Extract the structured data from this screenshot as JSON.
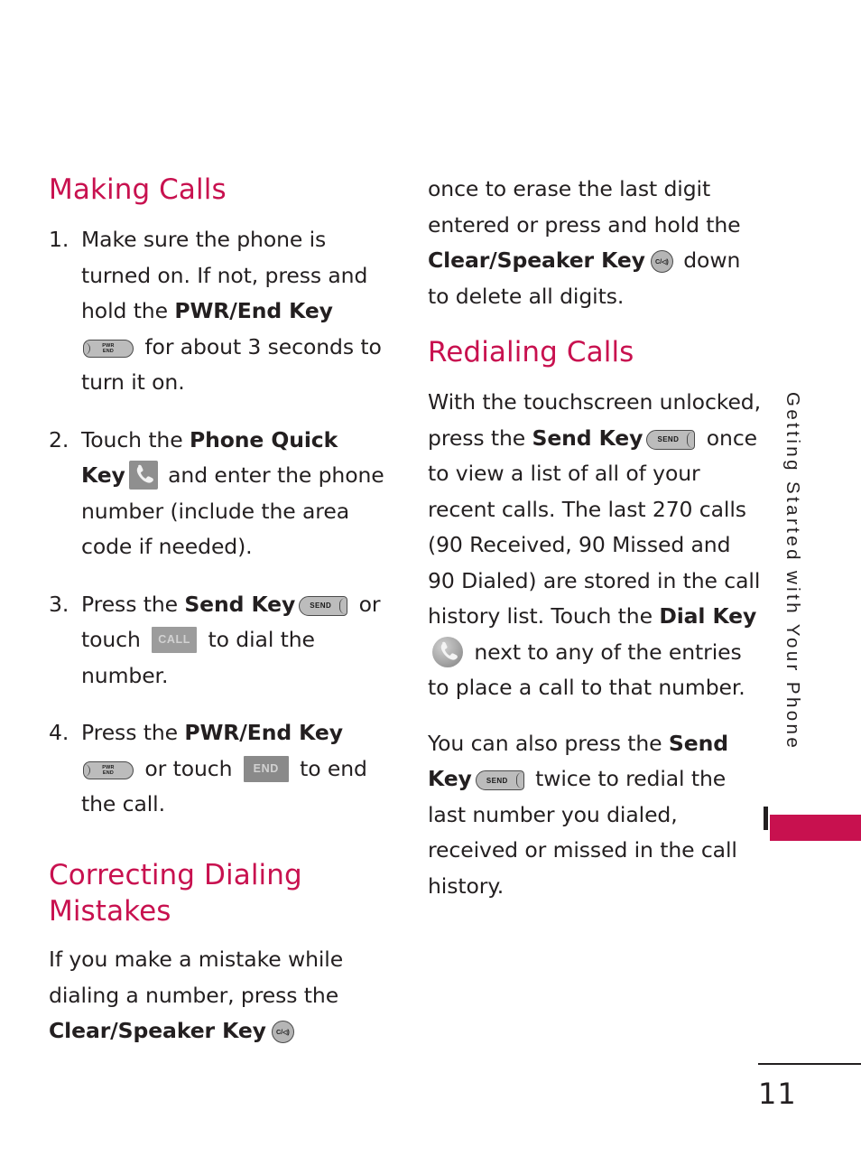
{
  "page": {
    "number": "11",
    "side_tab_label": "Getting Started with Your Phone",
    "accent_color": "#c8114f",
    "text_color": "#231f20"
  },
  "left_column": {
    "heading_making_calls": "Making Calls",
    "steps": [
      {
        "num": "1.",
        "part1": "Make sure the phone is turned on. If not, press and hold the ",
        "bold1": "PWR/End Key",
        "icon1": "pwr-end-key",
        "part2": " for about 3 seconds to turn it on."
      },
      {
        "num": "2.",
        "part1": "Touch the ",
        "bold1": "Phone Quick Key",
        "icon1": "phone-quick-key",
        "part2": " and enter the phone number (include the area code if needed)."
      },
      {
        "num": "3.",
        "part1": "Press the ",
        "bold1": "Send Key",
        "icon1": "send-key",
        "part2": " or touch ",
        "icon2": "call-softkey",
        "part3": " to dial the number."
      },
      {
        "num": "4.",
        "part1": "Press the ",
        "bold1": "PWR/End Key",
        "icon1": "pwr-end-key",
        "part2": " or touch ",
        "icon2": "end-softkey",
        "part3": " to end the call."
      }
    ],
    "heading_correcting": "Correcting Dialing Mistakes",
    "correcting_para": {
      "part1": "If you make a mistake while dialing a number, press the ",
      "bold1": "Clear/Speaker Key",
      "icon1": "clear-speaker-key"
    }
  },
  "right_column": {
    "continued_para": {
      "part1": "once to erase the last digit entered or press and hold the ",
      "bold1": "Clear/Speaker Key",
      "icon1": "clear-speaker-key",
      "part2": " down to delete all digits."
    },
    "heading_redialing": "Redialing Calls",
    "redial_para": {
      "part1": "With the touchscreen unlocked, press the ",
      "bold1": "Send Key",
      "icon1": "send-key",
      "part2": " once to view a list of all of your recent calls. The last 270 calls (90 Received, 90 Missed and 90 Dialed) are stored in the call history list. Touch the ",
      "bold2": "Dial Key",
      "icon2": "dial-key",
      "part3": " next to any of the entries to place a call to that number."
    },
    "also_para": {
      "part1": "You can also press the ",
      "bold1": "Send Key",
      "icon1": "send-key",
      "part2": " twice to redial the last number you dialed, received or missed in the call history."
    }
  },
  "keys": {
    "pwr_end_line1": "PWR",
    "pwr_end_line2": "END",
    "send_label": "SEND",
    "clear_label": "C/◁)",
    "call_label": "CALL",
    "end_label": "END"
  }
}
